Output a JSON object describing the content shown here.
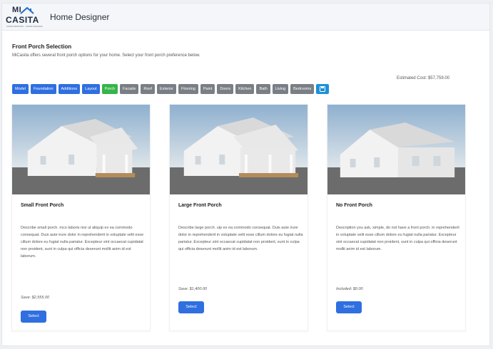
{
  "header": {
    "logo_mi": "MI",
    "logo_casita": "CASITA",
    "logo_tagline": "CASAS BONITAS · CASAS SOLIDAS",
    "app_title": "Home Designer"
  },
  "section": {
    "title": "Front Porch Selection",
    "description": "MiCasita offers several front porch options for your home. Select your front porch preference below.",
    "estimated_cost": "Estimated Cost: $57,759.00"
  },
  "tabs": [
    {
      "label": "Model",
      "state": "done"
    },
    {
      "label": "Foundation",
      "state": "done"
    },
    {
      "label": "Additions",
      "state": "done"
    },
    {
      "label": "Layout",
      "state": "done"
    },
    {
      "label": "Porch",
      "state": "active"
    },
    {
      "label": "Facade",
      "state": "pending"
    },
    {
      "label": "Roof",
      "state": "pending"
    },
    {
      "label": "Exterior",
      "state": "pending"
    },
    {
      "label": "Flooring",
      "state": "pending"
    },
    {
      "label": "Paint",
      "state": "pending"
    },
    {
      "label": "Doors",
      "state": "pending"
    },
    {
      "label": "Kitchen",
      "state": "pending"
    },
    {
      "label": "Bath",
      "state": "pending"
    },
    {
      "label": "Living",
      "state": "pending"
    },
    {
      "label": "Bedrooms",
      "state": "pending"
    }
  ],
  "tab_icon": "save-icon",
  "colors": {
    "done": "#2f6fe0",
    "active": "#36b54a",
    "pending": "#7a7e85",
    "icon": "#1e90d6"
  },
  "cards": [
    {
      "title": "Small Front Porch",
      "description": "Describe small porch. mco laboris nisi ut aliquip ex ea commodo consequat. Duis aute irure dolor in reprehenderit in voluptate velit esse cillum dolore eu fugiat nulla pariatur. Excepteur sint occaecat cupidatat non proident, sunt in culpa qui officia deserunt mollit anim id est laborum.",
      "price": "Save: $2,555.00",
      "button": "Select"
    },
    {
      "title": "Large Front Porch",
      "description": "Describe large porch. uip ex ea commodo consequat. Duis aute irure dolor in reprehenderit in voluptate velit esse cillum dolore eu fugiat nulla pariatur. Excepteur sint occaecat cupidatat non proident, sunt in culpa qui officia deserunt mollit anim id est laborum.",
      "price": "Save: $1,400.00",
      "button": "Select"
    },
    {
      "title": "No Front Porch",
      "description": "Description you ask, simple, do not have a front porch. in reprehenderit in voluptate velit esse cillum dolore eu fugiat nulla pariatur. Excepteur sint occaecat cupidatat non proident, sunt in culpa qui officia deserunt mollit anim id est laborum.",
      "price": "Included: $0.00",
      "button": "Select"
    }
  ]
}
